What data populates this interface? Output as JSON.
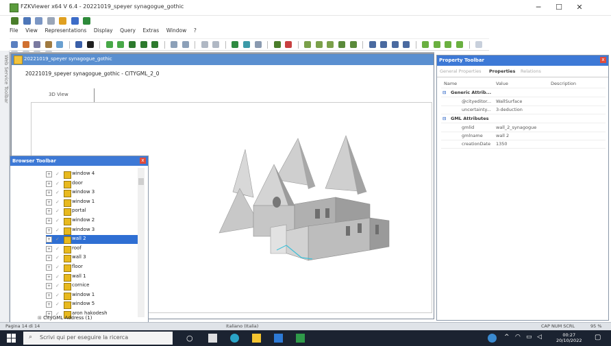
{
  "window": {
    "title": "FZKViewer x64 V 6.4 - 20221019_speyer synagogue_gothic",
    "minimize": "─",
    "maximize": "☐",
    "close": "✕"
  },
  "menu": [
    "File",
    "View",
    "Representations",
    "Display",
    "Query",
    "Extras",
    "Window",
    "?"
  ],
  "document": {
    "title": "20221019_speyer synagogue_gothic",
    "subtitle": "20221019_speyer synagogue_gothic - CITYGML_2_0",
    "view_tab": "3D View"
  },
  "side_tab": "Web Service Toolbar",
  "property_toolbar": {
    "title": "Property Toolbar",
    "close": "x",
    "tabs": [
      "General Properties",
      "Properties",
      "Relations"
    ],
    "columns": [
      "Name",
      "Value",
      "Description"
    ],
    "groups": [
      {
        "label": "Generic Attrib...",
        "rows": [
          {
            "name": "@cityeditor...",
            "value": "WallSurface"
          },
          {
            "name": "uncertainty...",
            "value": "3-deduction"
          }
        ]
      },
      {
        "label": "GML Attributes",
        "rows": [
          {
            "name": "gmlid",
            "value": "wall_2_synagogue"
          },
          {
            "name": "gmlname",
            "value": "wall 2"
          },
          {
            "name": "creationDate",
            "value": "1350"
          }
        ]
      }
    ]
  },
  "browser": {
    "title": "Browser Toolbar",
    "close": "x",
    "items": [
      {
        "label": "window 4",
        "selected": false
      },
      {
        "label": "door",
        "selected": false
      },
      {
        "label": "window 3",
        "selected": false
      },
      {
        "label": "window 1",
        "selected": false
      },
      {
        "label": "portal",
        "selected": false
      },
      {
        "label": "window 2",
        "selected": false
      },
      {
        "label": "window 3",
        "selected": false
      },
      {
        "label": "wall 2",
        "selected": true
      },
      {
        "label": "roof",
        "selected": false
      },
      {
        "label": "wall 3",
        "selected": false
      },
      {
        "label": "floor",
        "selected": false
      },
      {
        "label": "wall 1",
        "selected": false
      },
      {
        "label": "cornice",
        "selected": false
      },
      {
        "label": "window 1",
        "selected": false
      },
      {
        "label": "window 5",
        "selected": false
      },
      {
        "label": "aron hakodesh",
        "selected": false
      }
    ],
    "address": "CityGML Address (1)"
  },
  "statusbar": {
    "page": "Pagina 14 di 14",
    "language": "Italiano (Italia)",
    "caps": "CAP NUM SCRL",
    "zoom": "95 %"
  },
  "taskbar": {
    "search_placeholder": "Scrivi qui per eseguire la ricerca",
    "time": "00:27",
    "date": "20/10/2022"
  }
}
